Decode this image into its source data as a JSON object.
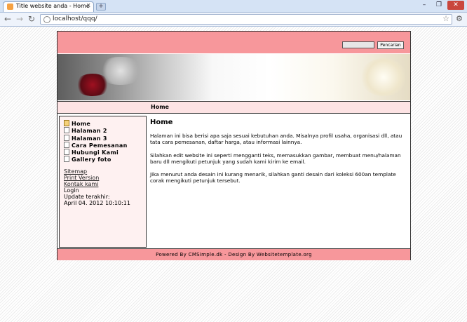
{
  "browser": {
    "tab_title": "Title website anda - Home",
    "tab_close": "x",
    "new_tab": "+",
    "url": "localhost/qqq/",
    "window_controls": [
      "–",
      "❐",
      "✕"
    ]
  },
  "header": {
    "search_button": "Pencarian"
  },
  "nav": {
    "crumb": "Home"
  },
  "menu": {
    "items": [
      "Home",
      "Halaman 2",
      "Halaman 3",
      "Cara Pemesanan",
      "Hubungi Kami",
      "Gallery foto"
    ]
  },
  "sidebar": {
    "sitemap": "Sitemap",
    "print": "Print Version",
    "contact": "Kontak kami",
    "login": "Login",
    "update_label": "Update terakhir:",
    "update_date": "April 04. 2012 10:10:11"
  },
  "content": {
    "title": "Home",
    "p1": "Halaman ini bisa berisi apa saja sesuai kebutuhan anda. Misalnya profil usaha, organisasi dll, atau tata cara pemesanan, daftar harga, atau informasi lainnya.",
    "p2": "Silahkan edit website ini seperti mengganti teks, memasukkan gambar, membuat menu/halaman baru dll mengikuti petunjuk yang sudah kami kirim ke email.",
    "p3": "Jika menurut anda desain ini kurang menarik, silahkan ganti desain dari koleksi 600an template corak mengikuti petunjuk tersebut."
  },
  "footer": {
    "text": "Powered By CMSimple.dk - Design By Websitetemplate.org"
  },
  "colors": {
    "header_pink": "#f7979b",
    "sidebar_bg": "#fef1f1",
    "nav_bg": "#fde3e4"
  }
}
